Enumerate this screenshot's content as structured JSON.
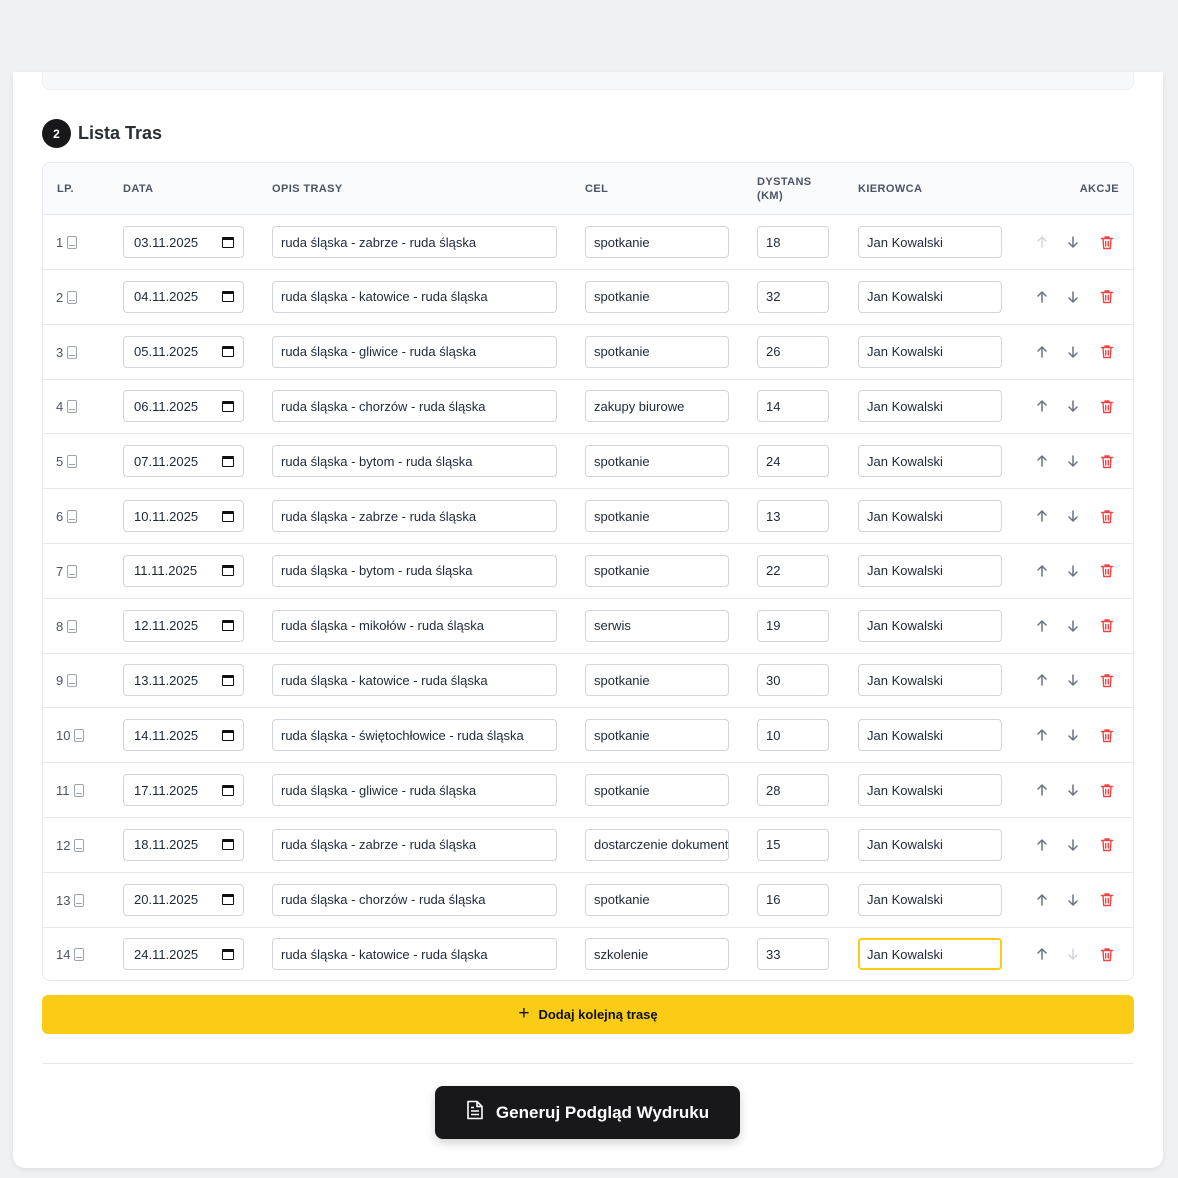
{
  "section": {
    "step": "2",
    "title": "Lista Tras"
  },
  "table": {
    "headers": {
      "lp": "LP.",
      "date": "DATA",
      "desc": "OPIS TRASY",
      "goal": "CEL",
      "distance_line1": "DYSTANS",
      "distance_line2": "(KM)",
      "driver": "KIEROWCA",
      "actions": "AKCJE"
    },
    "rows": [
      {
        "num": "1",
        "date": "03.11.2025",
        "desc": "ruda śląska - zabrze - ruda śląska",
        "goal": "spotkanie",
        "distance": "18",
        "driver": "Jan Kowalski"
      },
      {
        "num": "2",
        "date": "04.11.2025",
        "desc": "ruda śląska - katowice - ruda śląska",
        "goal": "spotkanie",
        "distance": "32",
        "driver": "Jan Kowalski"
      },
      {
        "num": "3",
        "date": "05.11.2025",
        "desc": "ruda śląska - gliwice - ruda śląska",
        "goal": "spotkanie",
        "distance": "26",
        "driver": "Jan Kowalski"
      },
      {
        "num": "4",
        "date": "06.11.2025",
        "desc": "ruda śląska - chorzów - ruda śląska",
        "goal": "zakupy biurowe",
        "distance": "14",
        "driver": "Jan Kowalski"
      },
      {
        "num": "5",
        "date": "07.11.2025",
        "desc": "ruda śląska - bytom - ruda śląska",
        "goal": "spotkanie",
        "distance": "24",
        "driver": "Jan Kowalski"
      },
      {
        "num": "6",
        "date": "10.11.2025",
        "desc": "ruda śląska - zabrze - ruda śląska",
        "goal": "spotkanie",
        "distance": "13",
        "driver": "Jan Kowalski"
      },
      {
        "num": "7",
        "date": "11.11.2025",
        "desc": "ruda śląska - bytom - ruda śląska",
        "goal": "spotkanie",
        "distance": "22",
        "driver": "Jan Kowalski"
      },
      {
        "num": "8",
        "date": "12.11.2025",
        "desc": "ruda śląska - mikołów - ruda śląska",
        "goal": "serwis",
        "distance": "19",
        "driver": "Jan Kowalski"
      },
      {
        "num": "9",
        "date": "13.11.2025",
        "desc": "ruda śląska - katowice - ruda śląska",
        "goal": "spotkanie",
        "distance": "30",
        "driver": "Jan Kowalski"
      },
      {
        "num": "10",
        "date": "14.11.2025",
        "desc": "ruda śląska - świętochłowice - ruda śląska",
        "goal": "spotkanie",
        "distance": "10",
        "driver": "Jan Kowalski"
      },
      {
        "num": "11",
        "date": "17.11.2025",
        "desc": "ruda śląska - gliwice - ruda śląska",
        "goal": "spotkanie",
        "distance": "28",
        "driver": "Jan Kowalski"
      },
      {
        "num": "12",
        "date": "18.11.2025",
        "desc": "ruda śląska - zabrze - ruda śląska",
        "goal": "dostarczenie dokumentów",
        "distance": "15",
        "driver": "Jan Kowalski"
      },
      {
        "num": "13",
        "date": "20.11.2025",
        "desc": "ruda śląska - chorzów - ruda śląska",
        "goal": "spotkanie",
        "distance": "16",
        "driver": "Jan Kowalski"
      },
      {
        "num": "14",
        "date": "24.11.2025",
        "desc": "ruda śląska - katowice - ruda śląska",
        "goal": "szkolenie",
        "distance": "33",
        "driver": "Jan Kowalski"
      }
    ]
  },
  "buttons": {
    "add_route": "Dodaj kolejną trasę",
    "generate_preview": "Generuj Podgląd Wydruku"
  },
  "colors": {
    "accent": "#facc15",
    "dark": "#18181b",
    "delete": "#ef4444",
    "action_icon": "#6b7280"
  },
  "icons": {
    "row": "document-icon",
    "date": "calendar-icon",
    "up": "arrow-up-icon",
    "down": "arrow-down-icon",
    "delete": "trash-icon",
    "add": "plus-icon",
    "generate": "file-text-icon"
  }
}
